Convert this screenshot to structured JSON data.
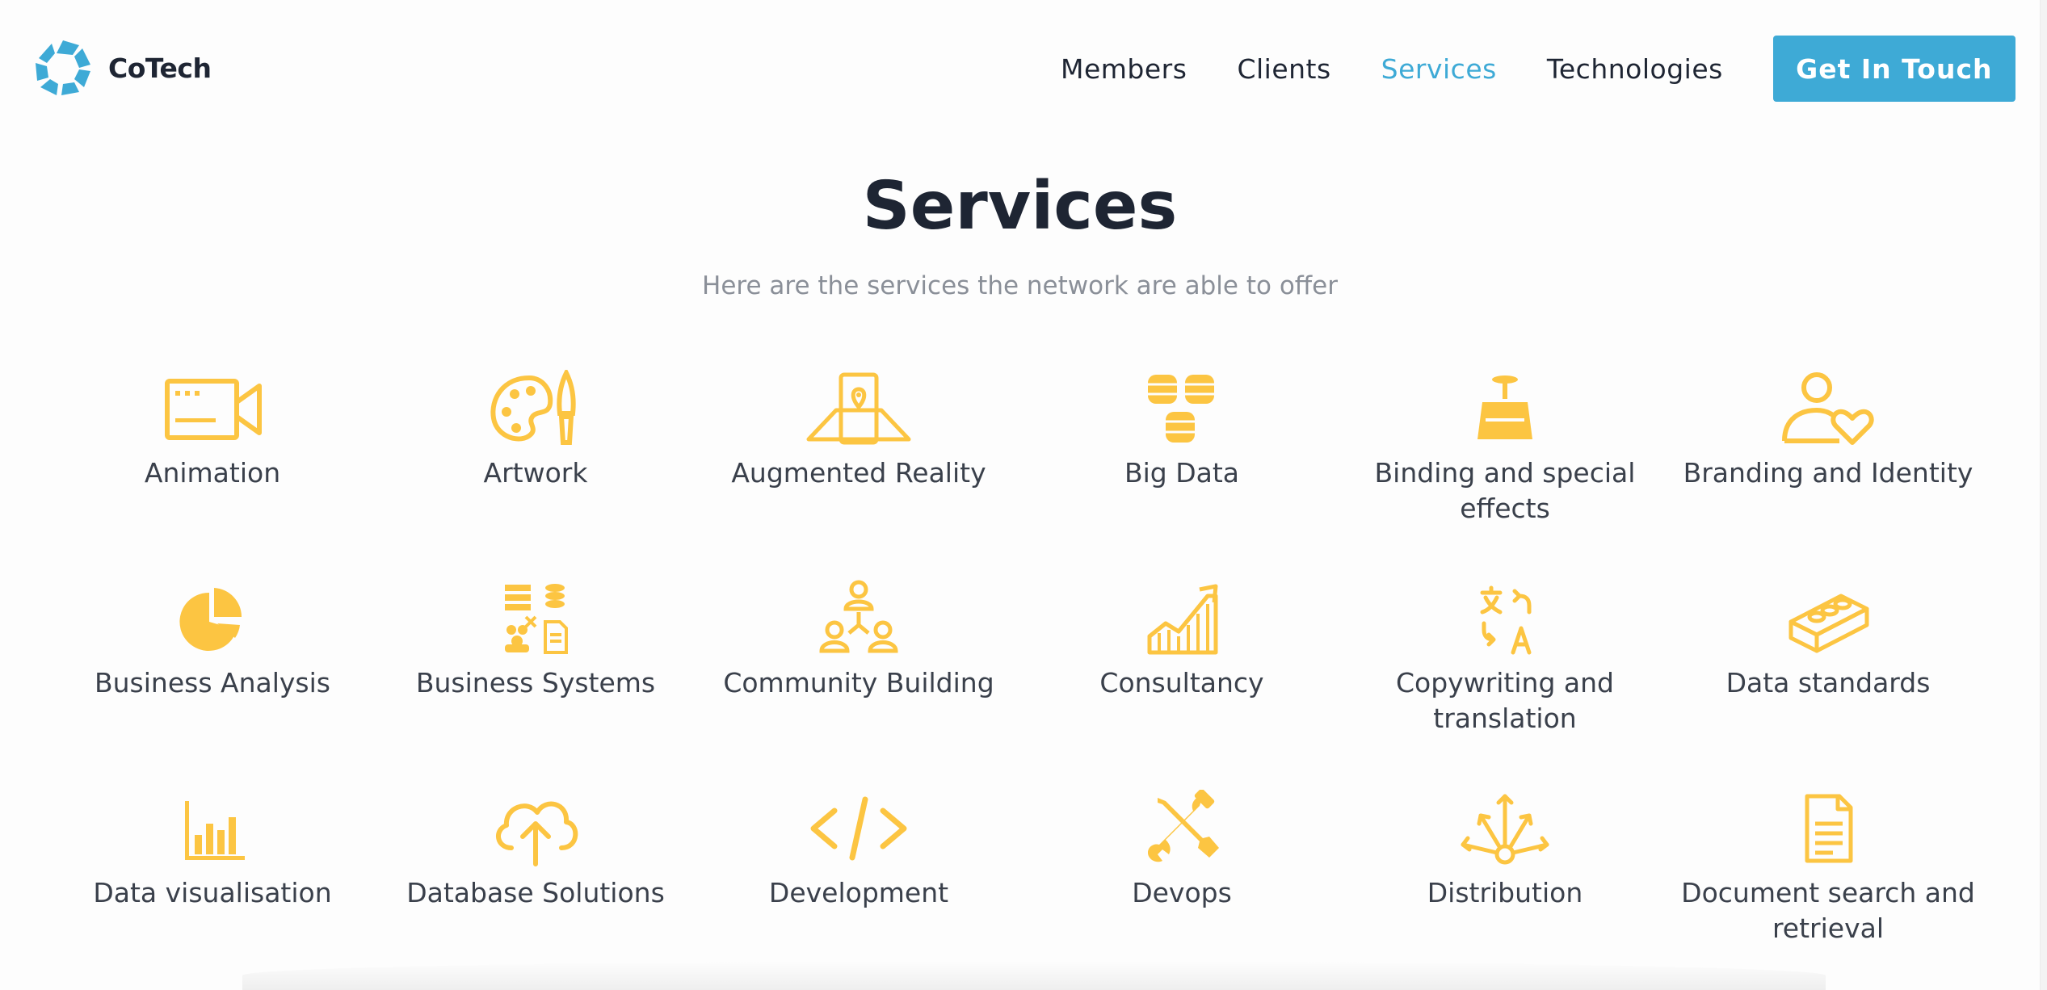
{
  "header": {
    "brand": "CoTech",
    "nav": [
      {
        "label": "Members",
        "active": false
      },
      {
        "label": "Clients",
        "active": false
      },
      {
        "label": "Services",
        "active": true
      },
      {
        "label": "Technologies",
        "active": false
      }
    ],
    "cta_label": "Get In Touch"
  },
  "colors": {
    "accent": "#3eaad6",
    "icon": "#fcc542",
    "heading": "#1e2533",
    "subtitle": "#8a8f98"
  },
  "main": {
    "title": "Services",
    "subtitle": "Here are the services the network are able to offer",
    "services": [
      {
        "label": "Animation",
        "icon": "video-camera-icon"
      },
      {
        "label": "Artwork",
        "icon": "palette-brush-icon"
      },
      {
        "label": "Augmented Reality",
        "icon": "ar-phone-map-icon"
      },
      {
        "label": "Big Data",
        "icon": "coin-stacks-icon"
      },
      {
        "label": "Binding and special effects",
        "icon": "binding-machine-icon"
      },
      {
        "label": "Branding and Identity",
        "icon": "person-heart-icon"
      },
      {
        "label": "Business Analysis",
        "icon": "pie-chart-icon"
      },
      {
        "label": "Business Systems",
        "icon": "business-systems-icon"
      },
      {
        "label": "Community Building",
        "icon": "community-people-icon"
      },
      {
        "label": "Consultancy",
        "icon": "growth-chart-icon"
      },
      {
        "label": "Copywriting and translation",
        "icon": "translate-icon"
      },
      {
        "label": "Data standards",
        "icon": "lego-brick-icon"
      },
      {
        "label": "Data visualisation",
        "icon": "bar-chart-icon"
      },
      {
        "label": "Database Solutions",
        "icon": "cloud-upload-icon"
      },
      {
        "label": "Development",
        "icon": "code-icon"
      },
      {
        "label": "Devops",
        "icon": "tools-icon"
      },
      {
        "label": "Distribution",
        "icon": "distribution-arrows-icon"
      },
      {
        "label": "Document search and retrieval",
        "icon": "document-icon"
      }
    ]
  }
}
